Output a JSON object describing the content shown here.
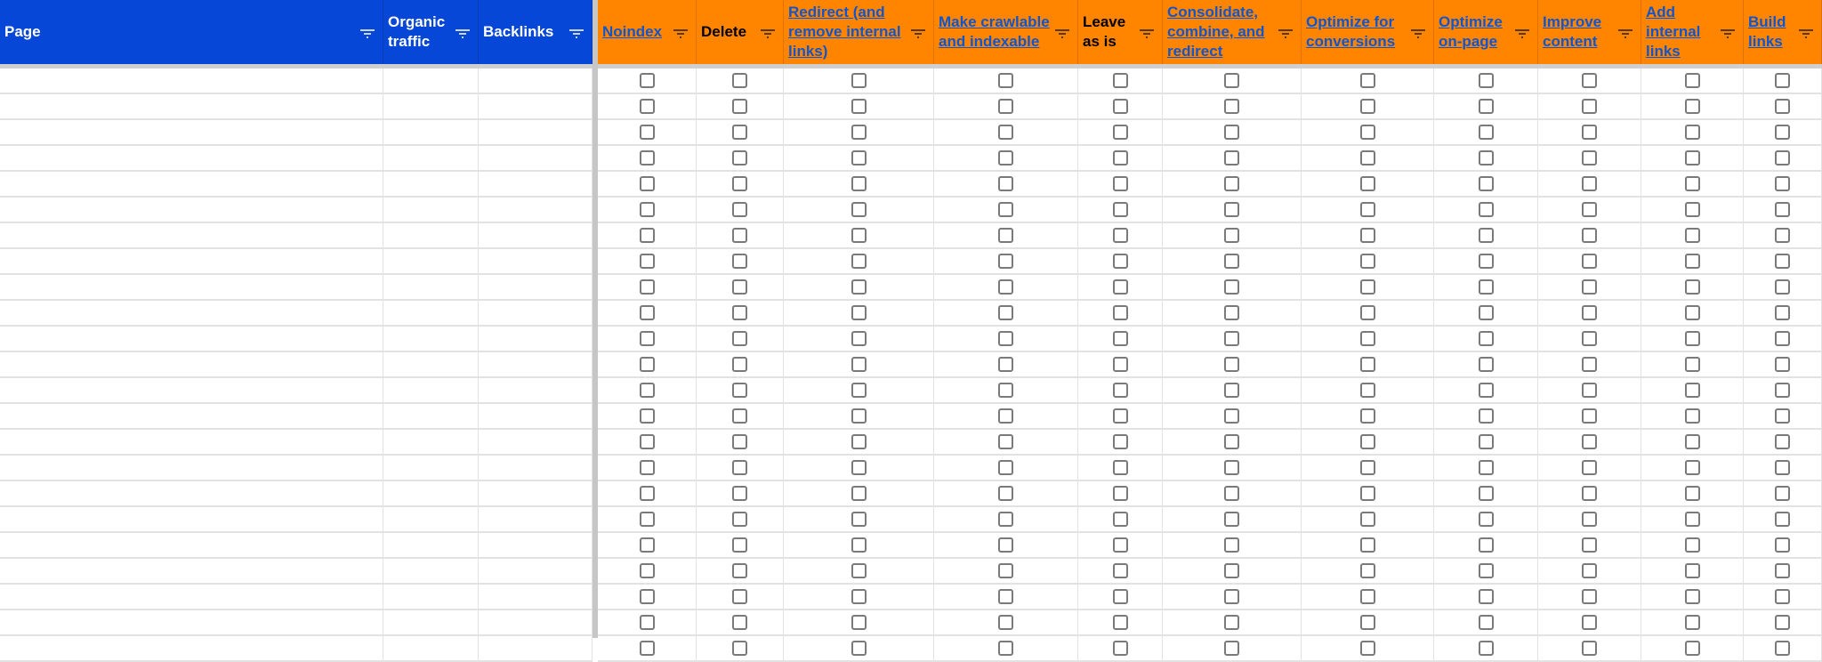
{
  "sheet": {
    "left_columns": [
      {
        "label": "Page",
        "filter_icon": "filter-icon"
      },
      {
        "label": "Organic traffic",
        "filter_icon": "filter-icon"
      },
      {
        "label": "Backlinks",
        "filter_icon": "filter-icon"
      }
    ],
    "action_columns": [
      {
        "label": "Noindex",
        "link": true
      },
      {
        "label": "Delete",
        "link": false
      },
      {
        "label": "Redirect (and remove internal links)",
        "link": true
      },
      {
        "label": "Make crawlable and indexable",
        "link": true
      },
      {
        "label": "Leave as is",
        "link": false
      },
      {
        "label": "Consolidate, combine, and redirect",
        "link": true
      },
      {
        "label": "Optimize for conversions",
        "link": true
      },
      {
        "label": "Optimize on-page",
        "link": true
      },
      {
        "label": "Improve content",
        "link": true
      },
      {
        "label": "Add internal links",
        "link": true
      },
      {
        "label": "Build links",
        "link": true
      }
    ],
    "visible_rows": 23,
    "checkbox_state": "unchecked",
    "colors": {
      "left_header_bg": "#0647d8",
      "action_header_bg": "#ff8500",
      "link_color": "#1155cc"
    }
  }
}
